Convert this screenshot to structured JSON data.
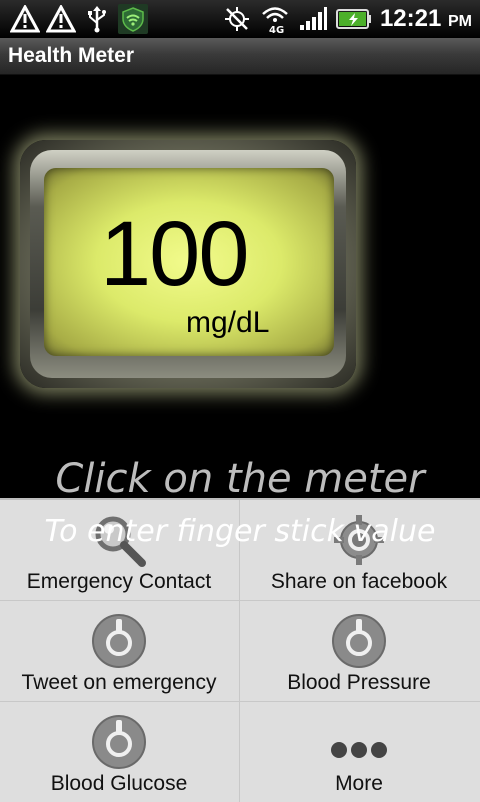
{
  "status_bar": {
    "time": "12:21",
    "ampm": "PM",
    "network": "4G",
    "icons": [
      "alert-icon",
      "alert-icon",
      "usb-icon",
      "shield-wifi-icon",
      "gps-off-icon",
      "wifi-4g-icon",
      "signal-icon",
      "battery-charging-icon"
    ]
  },
  "title_bar": {
    "title": "Health Meter"
  },
  "meter": {
    "value": "100",
    "unit": "mg/dL"
  },
  "hints": {
    "line1": "Click on the meter",
    "line2": "To enter finger stick value"
  },
  "menu": {
    "items": [
      {
        "label": "Emergency Contact",
        "icon": "magnifier-icon"
      },
      {
        "label": "Share on facebook",
        "icon": "crosshair-icon"
      },
      {
        "label": "Tweet on emergency",
        "icon": "dial-icon"
      },
      {
        "label": "Blood Pressure",
        "icon": "dial-icon"
      },
      {
        "label": "Blood Glucose",
        "icon": "dial-icon"
      },
      {
        "label": "More",
        "icon": "more-dots-icon"
      }
    ]
  },
  "colors": {
    "meter_screen": "#dcea6a",
    "menu_bg": "#ececec",
    "menu_icon": "#7a7a7a"
  }
}
